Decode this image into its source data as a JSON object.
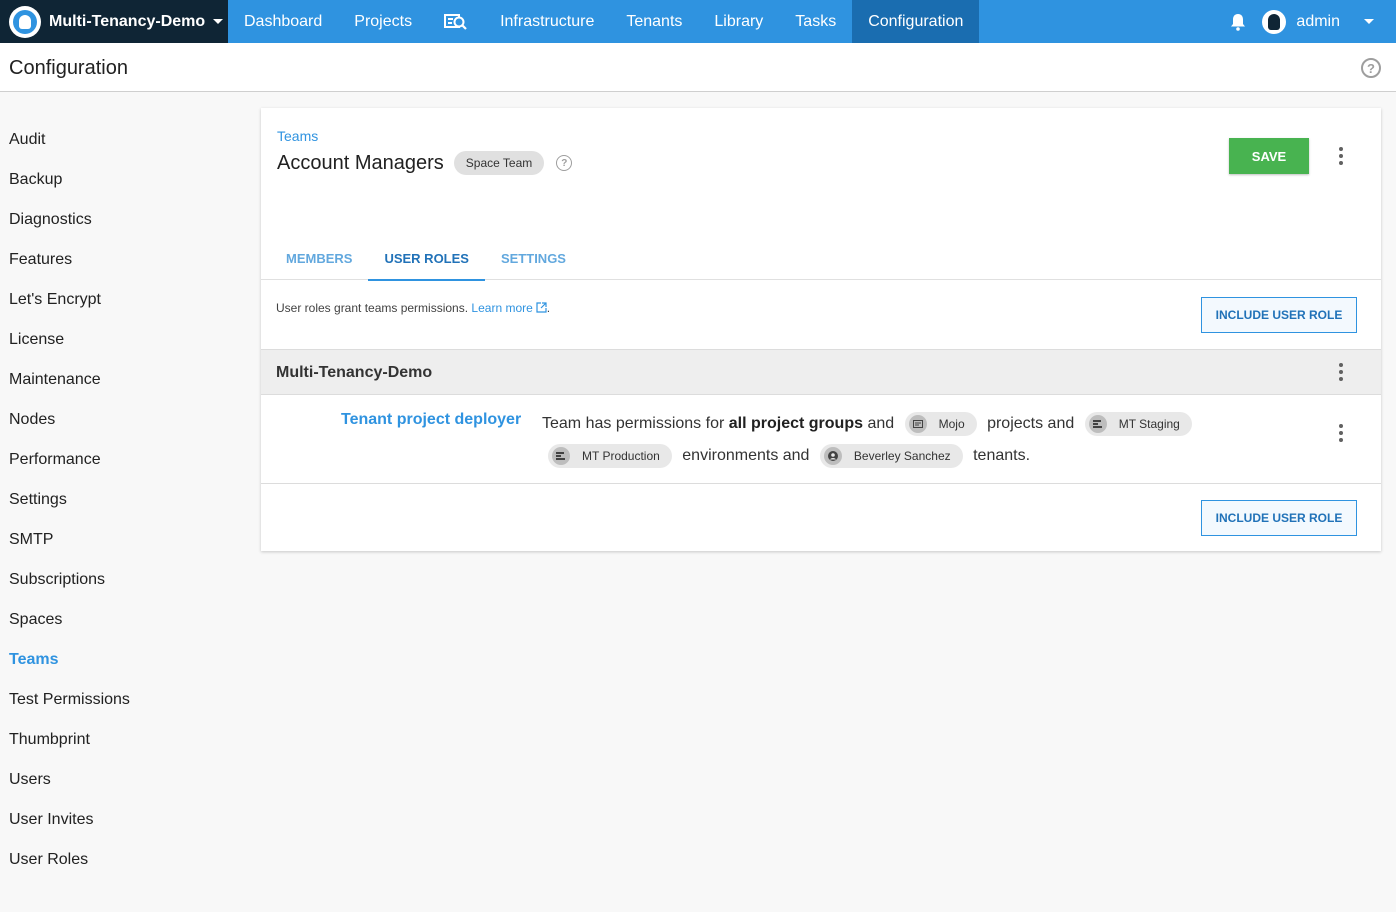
{
  "nav": {
    "space": "Multi-Tenancy-Demo",
    "items": [
      {
        "label": "Dashboard"
      },
      {
        "label": "Projects"
      },
      {
        "label": ""
      },
      {
        "label": "Infrastructure"
      },
      {
        "label": "Tenants"
      },
      {
        "label": "Library"
      },
      {
        "label": "Tasks"
      },
      {
        "label": "Configuration"
      }
    ],
    "user": "admin"
  },
  "page": {
    "title": "Configuration"
  },
  "sidebar": {
    "items": [
      {
        "label": "Audit"
      },
      {
        "label": "Backup"
      },
      {
        "label": "Diagnostics"
      },
      {
        "label": "Features"
      },
      {
        "label": "Let's Encrypt"
      },
      {
        "label": "License"
      },
      {
        "label": "Maintenance"
      },
      {
        "label": "Nodes"
      },
      {
        "label": "Performance"
      },
      {
        "label": "Settings"
      },
      {
        "label": "SMTP"
      },
      {
        "label": "Subscriptions"
      },
      {
        "label": "Spaces"
      },
      {
        "label": "Teams"
      },
      {
        "label": "Test Permissions"
      },
      {
        "label": "Thumbprint"
      },
      {
        "label": "Users"
      },
      {
        "label": "User Invites"
      },
      {
        "label": "User Roles"
      }
    ],
    "active": "Teams"
  },
  "team": {
    "breadcrumb": "Teams",
    "name": "Account Managers",
    "badge": "Space Team",
    "save_label": "SAVE"
  },
  "tabs": [
    {
      "label": "MEMBERS"
    },
    {
      "label": "USER ROLES"
    },
    {
      "label": "SETTINGS"
    }
  ],
  "roles": {
    "description": "User roles grant teams permissions.",
    "learn_more": "Learn more",
    "period": ".",
    "include_label": "INCLUDE USER ROLE",
    "space_name": "Multi-Tenancy-Demo",
    "role_name": "Tenant project deployer",
    "perm": {
      "t1": "Team has permissions for",
      "b1": "all project groups",
      "t2": "and",
      "project_chip": "Mojo",
      "t3": "projects and",
      "env_chip_1": "MT Staging",
      "env_chip_2": "MT Production",
      "t4": "environments and",
      "tenant_chip": "Beverley Sanchez",
      "t5": "tenants."
    }
  },
  "colors": {
    "nav_blue": "#2f93e0",
    "space_dark": "#0f2535",
    "save_green": "#48b350",
    "link_blue": "#2f93e0"
  }
}
